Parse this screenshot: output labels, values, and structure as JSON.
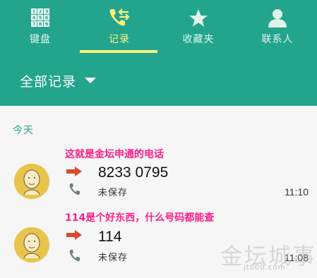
{
  "tabs": [
    {
      "label": "键盘",
      "icon": "keypad-icon"
    },
    {
      "label": "记录",
      "icon": "call-log-icon",
      "active": true
    },
    {
      "label": "收藏夹",
      "icon": "star-icon"
    },
    {
      "label": "联系人",
      "icon": "contact-icon"
    }
  ],
  "keypad_digits": [
    "1",
    "2",
    "3",
    "4",
    "5",
    "6",
    "7",
    "8",
    "9"
  ],
  "filter": {
    "label": "全部记录",
    "icon": "dropdown-caret-icon"
  },
  "section": {
    "label": "今天"
  },
  "calls": [
    {
      "annotation": "这就是金坛申通的电话",
      "number": "8233 0795",
      "status": "未保存",
      "time": "11:10",
      "direction_icon": "outgoing-arrow-icon"
    },
    {
      "annotation": "114是个好东西，什么号码都能查",
      "number": "114",
      "status": "未保存",
      "time": "11:08",
      "direction_icon": "outgoing-arrow-icon"
    }
  ],
  "watermark": {
    "text": "金坛城事",
    "url": "jt000.com"
  },
  "colors": {
    "header": "#22a58c",
    "active_tab": "#fff27a",
    "arrow": "#d84a2c",
    "annotation": "#ff1f8a",
    "avatar": "#e8c44a"
  }
}
